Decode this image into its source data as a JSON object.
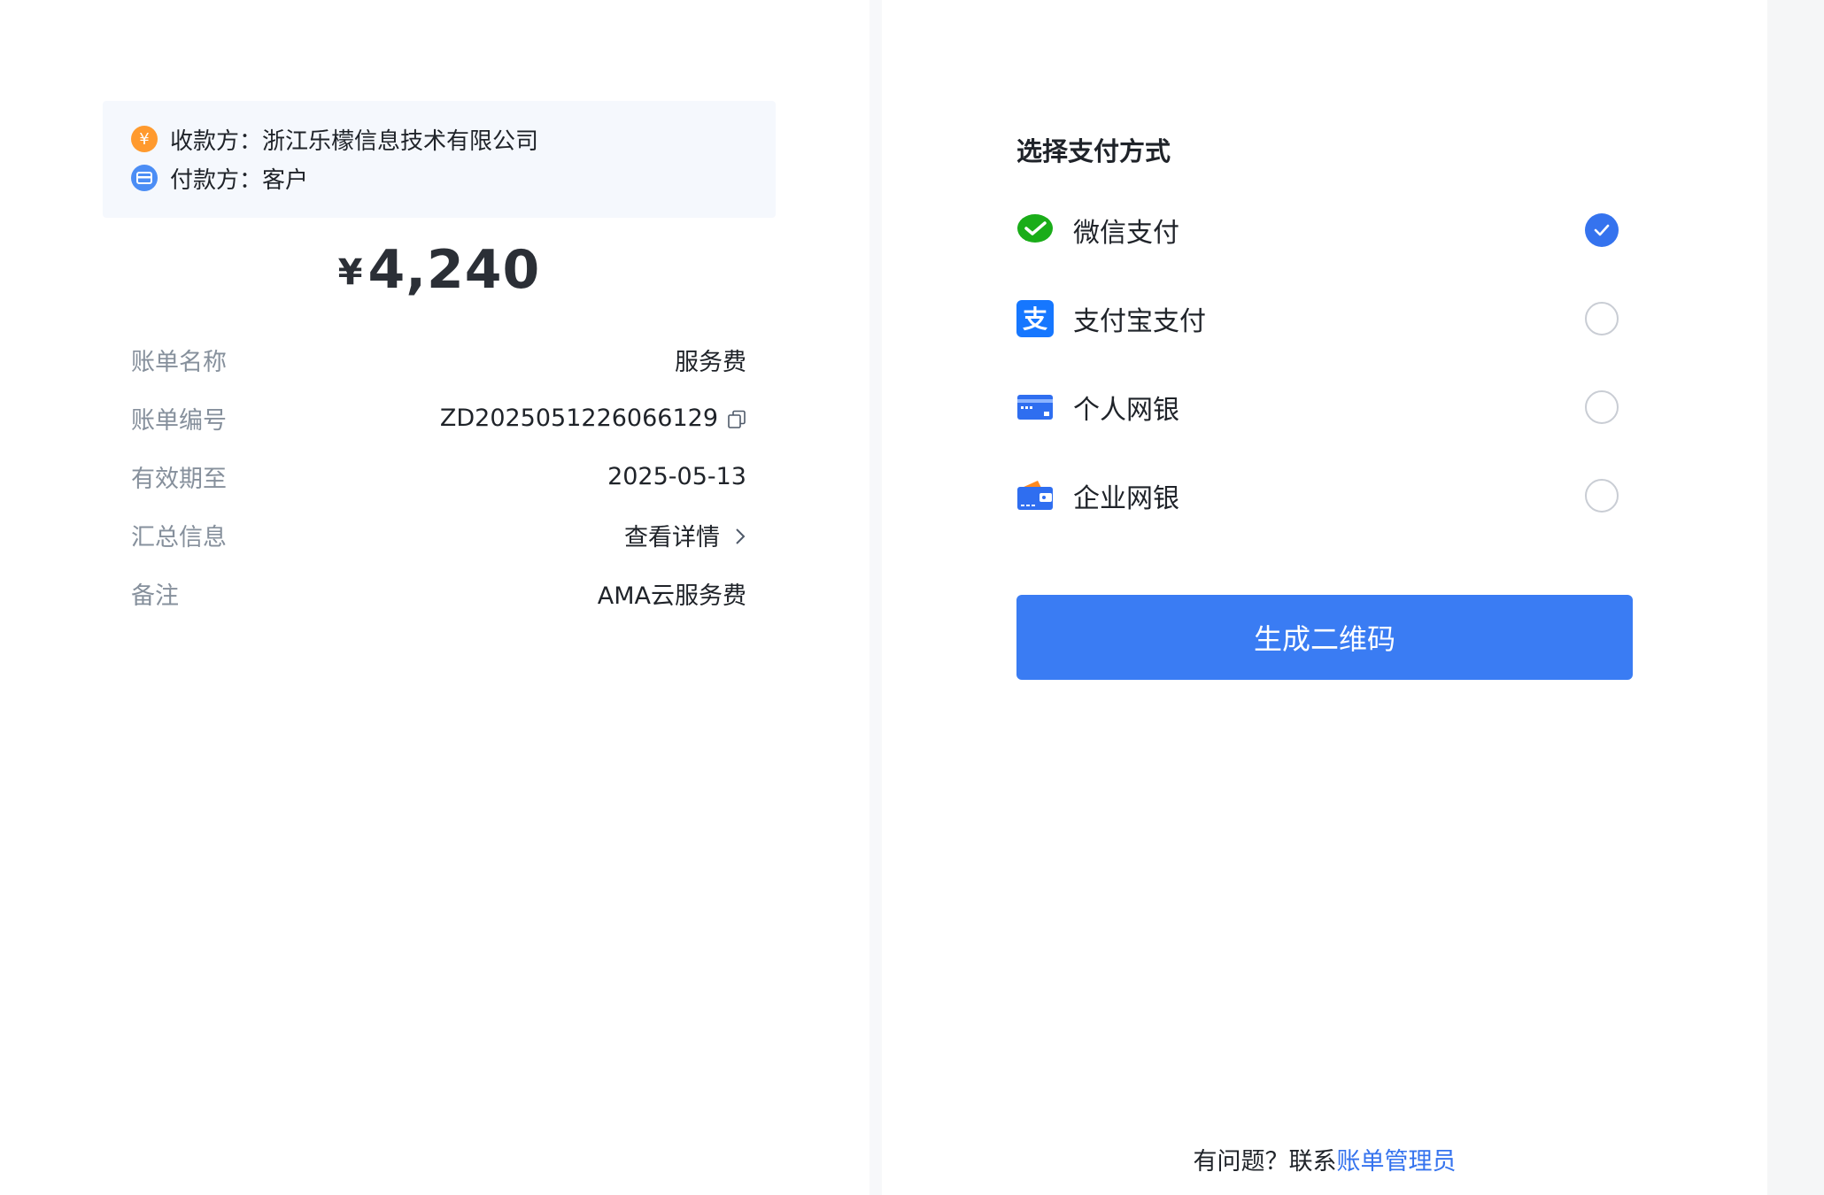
{
  "bill": {
    "payee_label": "收款方：",
    "payee_value": "浙江乐檬信息技术有限公司",
    "payer_label": "付款方：",
    "payer_value": "客户",
    "currency_symbol": "¥",
    "amount": "4,240",
    "details": [
      {
        "label": "账单名称",
        "value": "服务费"
      },
      {
        "label": "账单编号",
        "value": "ZD2025051226066129"
      },
      {
        "label": "有效期至",
        "value": "2025-05-13"
      },
      {
        "label": "汇总信息",
        "value": "查看详情"
      },
      {
        "label": "备注",
        "value": "AMA云服务费"
      }
    ]
  },
  "payment": {
    "title": "选择支付方式",
    "methods": [
      {
        "label": "微信支付",
        "icon": "wechat-pay-icon",
        "selected": true
      },
      {
        "label": "支付宝支付",
        "icon": "alipay-icon",
        "selected": false
      },
      {
        "label": "个人网银",
        "icon": "bank-card-icon",
        "selected": false
      },
      {
        "label": "企业网银",
        "icon": "wallet-icon",
        "selected": false
      }
    ],
    "submit_label": "生成二维码"
  },
  "help": {
    "text": "有问题？联系",
    "link": "账单管理员"
  },
  "colors": {
    "primary": "#3A7CF3",
    "wechat_green": "#1AAD19",
    "payee_orange": "#FF9A2E",
    "payer_blue": "#4B8DF5"
  }
}
